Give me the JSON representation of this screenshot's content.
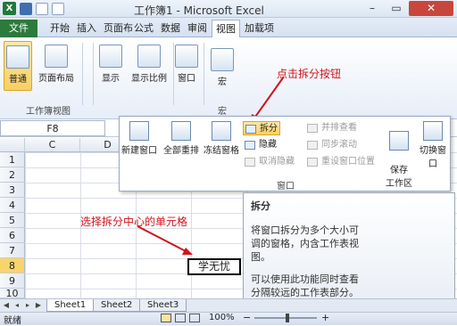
{
  "titlebar": {
    "title": "工作簿1 - Microsoft Excel",
    "logo": "X",
    "min": "–",
    "max": "▭",
    "close": "✕"
  },
  "tabs": [
    "文件",
    "开始",
    "插入",
    "页面布",
    "公式",
    "数据",
    "审阅",
    "视图",
    "加载项"
  ],
  "ribbon": {
    "normal": "普通",
    "page_layout": "页面布局",
    "show": "显示",
    "zoom": "显示比例",
    "window": "窗口",
    "macro": "宏",
    "group_views": "工作簿视图",
    "group_macro": "宏",
    "callout": "点击拆分按钮"
  },
  "formula": {
    "namebox": "F8"
  },
  "columns": [
    "C",
    "D"
  ],
  "rows": [
    "1",
    "2",
    "3",
    "4",
    "5",
    "6",
    "7",
    "8",
    "9",
    "10",
    "11"
  ],
  "selected_row": "8",
  "active_cell_text": "学无忧",
  "sel_callout": "选择拆分中心的单元格",
  "panel": {
    "new_window": "新建窗口",
    "arrange_all": "全部重排",
    "freeze": "冻结窗格",
    "split": "拆分",
    "hide": "隐藏",
    "unhide": "取消隐藏",
    "side_by_side": "并排查看",
    "sync_scroll": "同步滚动",
    "reset_pos": "重设窗口位置",
    "save_workspace": "保存\n工作区",
    "switch_windows": "切换窗口",
    "group_label": "窗口"
  },
  "tooltip": {
    "title": "拆分",
    "para1": "将窗口拆分为多个大小可调的窗格，内含工作表视图。",
    "para2": "可以使用此功能同时查看分隔较远的工作表部分。"
  },
  "sheets": [
    "Sheet1",
    "Sheet2",
    "Sheet3"
  ],
  "status": {
    "ready": "就绪",
    "zoom": "100%",
    "minus": "−",
    "plus": "+"
  },
  "colors": {
    "file_tab": "#2c7a3c",
    "callout_red": "#d0121a",
    "selected": "#f8cf63"
  }
}
